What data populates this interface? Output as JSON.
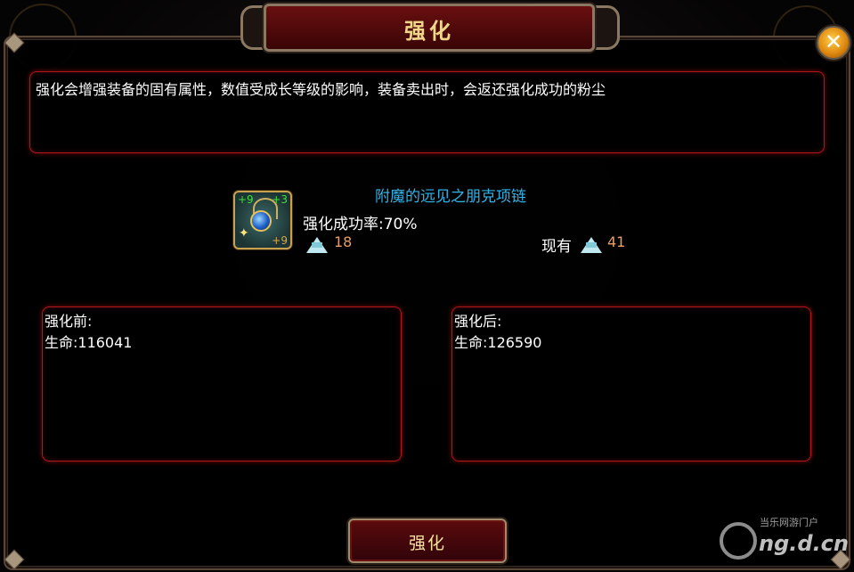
{
  "dialog": {
    "title": "强化",
    "description": "强化会增强装备的固有属性，数值受成长等级的影响，装备卖出时，会返还强化成功的粉尘"
  },
  "item": {
    "name": "附魔的远见之朋克项链",
    "tag_top_left": "+9",
    "tag_top_right": "+3",
    "tag_bottom_right": "+9",
    "icon": "necklace-icon",
    "success_rate": "强化成功率:70%",
    "cost": "18",
    "owned_label": "现有",
    "owned": "41",
    "currency_icon": "dust-crystal-icon"
  },
  "before": {
    "heading": "强化前:",
    "stat": "生命:116041"
  },
  "after": {
    "heading": "强化后:",
    "stat": "生命:126590"
  },
  "actions": {
    "enhance_label": "强化",
    "close_icon": "close-icon"
  },
  "watermark": {
    "site": "当乐网游门户",
    "domain": "ng.d.cn"
  },
  "colors": {
    "title_text": "#f0d68a",
    "item_name": "#30b4e8",
    "currency_value": "#e59d6a",
    "box_border": "#b0161a"
  }
}
